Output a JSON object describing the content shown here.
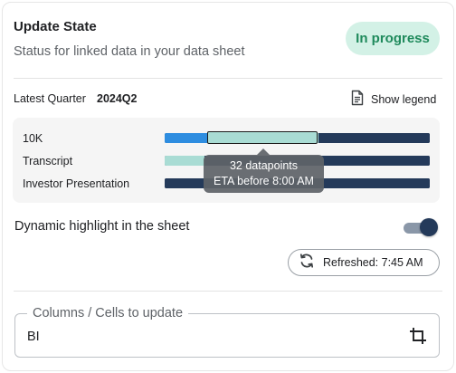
{
  "header": {
    "title": "Update State",
    "subtitle": "Status for linked data in your data sheet",
    "status_badge": "In progress"
  },
  "quarter": {
    "label": "Latest Quarter",
    "value": "2024Q2",
    "legend_button": "Show legend",
    "legend_icon": "document-icon"
  },
  "timeline": {
    "rows": [
      {
        "label": "10K",
        "segments": [
          {
            "status": "complete",
            "color": "#2e8de0",
            "fraction": 0.16
          },
          {
            "status": "updating",
            "color": "#a9dcd4",
            "fraction": 0.42,
            "selected": true
          },
          {
            "status": "pending",
            "color": "#243a5a",
            "fraction": 0.42
          }
        ]
      },
      {
        "label": "Transcript",
        "segments": [
          {
            "status": "updating",
            "color": "#a9dcd4",
            "fraction": 0.15
          },
          {
            "status": "pending",
            "color": "#243a5a",
            "fraction": 0.85
          }
        ]
      },
      {
        "label": "Investor Presentation",
        "segments": [
          {
            "status": "pending",
            "color": "#243a5a",
            "fraction": 1.0
          }
        ]
      }
    ],
    "tooltip": {
      "line1": "32 datapoints",
      "line2": "ETA before 8:00 AM"
    }
  },
  "highlight": {
    "label": "Dynamic highlight in the sheet",
    "enabled": true
  },
  "refresh": {
    "label": "Refreshed: 7:45 AM",
    "icon": "refresh-icon"
  },
  "columns_field": {
    "label": "Columns / Cells to update",
    "value": "BI",
    "icon": "crop-icon"
  },
  "colors": {
    "badge_bg": "#d3f1e6",
    "badge_text": "#1f8a5c",
    "navy": "#243a5a",
    "blue": "#2e8de0",
    "teal": "#a9dcd4"
  }
}
